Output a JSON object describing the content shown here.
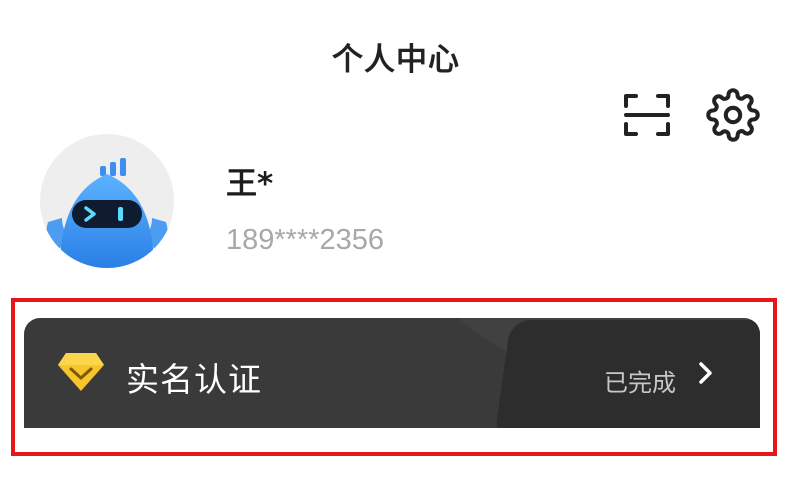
{
  "header": {
    "title": "个人中心"
  },
  "toolbar": {
    "scan_icon": "scan-icon",
    "settings_icon": "gear-icon"
  },
  "profile": {
    "avatar_icon": "robot-avatar",
    "name": "王*",
    "phone": "189****2356"
  },
  "verification": {
    "icon": "diamond-icon",
    "title": "实名认证",
    "status": "已完成",
    "chevron_icon": "chevron-right-icon"
  },
  "colors": {
    "highlight_border": "#e8161b",
    "card_background": "#3a3a3a",
    "diamond_gold": "#f7c52b",
    "avatar_blue": "#3b8ff0"
  }
}
